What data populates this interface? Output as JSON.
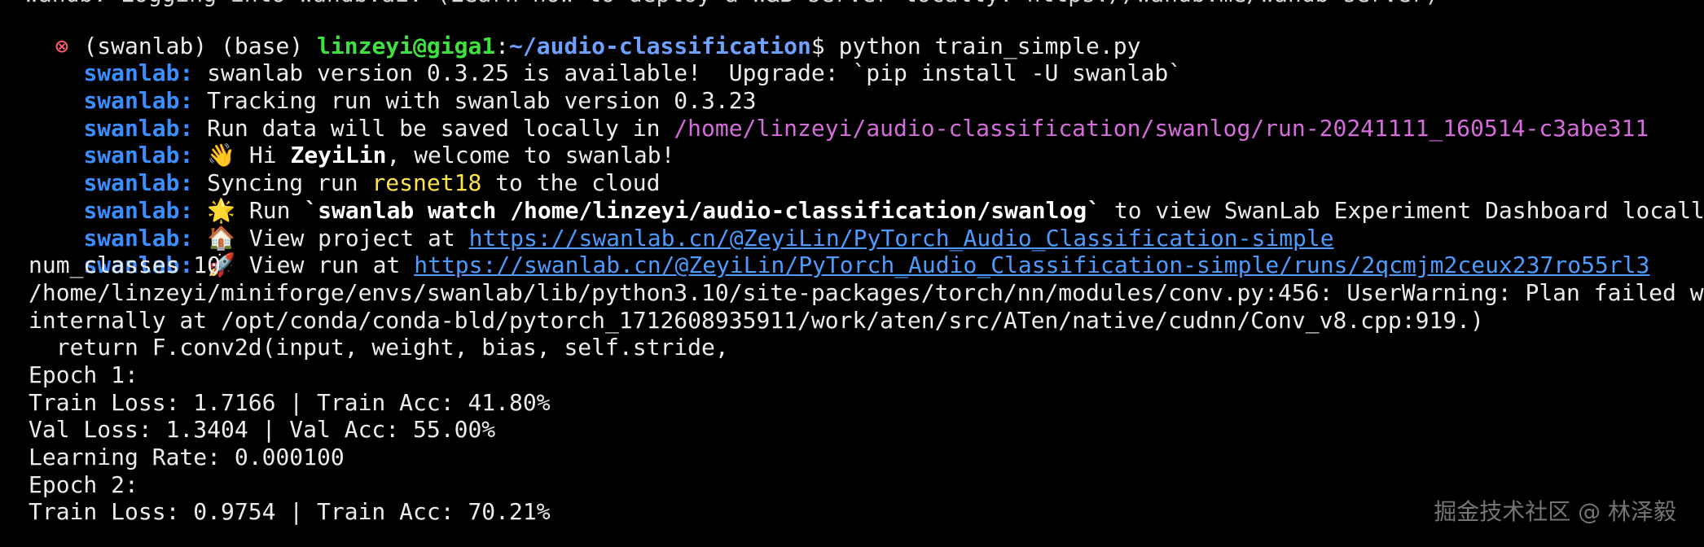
{
  "terminal": {
    "cut_line": "wandb: Logging into wandb.ai. (Learn how to deploy a W&B server locally: https://wandb.me/wandb-server)",
    "prompt": {
      "env": "(swanlab) (base) ",
      "user_host": "linzeyi@giga1",
      "colon": ":",
      "path": "~/audio-classification",
      "symbol": "$ ",
      "command": "python train_simple.py"
    },
    "prefix": "swanlab:",
    "lines": {
      "version_available": " swanlab version 0.3.25 is available!  Upgrade: `pip install -U swanlab`",
      "tracking": " Tracking run with swanlab version 0.3.23",
      "run_data_pre": " Run data will be saved locally in ",
      "run_data_path": "/home/linzeyi/audio-classification/swanlog/run-20241111_160514-c3abe311",
      "hi_icon": "👋",
      "hi_pre": " Hi ",
      "hi_name": "ZeyiLin",
      "hi_post": ", welcome to swanlab!",
      "sync_pre": " Syncing run ",
      "sync_run": "resnet18",
      "sync_post": " to the cloud",
      "watch_icon": "🌟",
      "watch_pre": " Run ",
      "watch_cmd": "`swanlab watch /home/linzeyi/audio-classification/swanlog`",
      "watch_post": " to view SwanLab Experiment Dashboard locally",
      "project_icon": "🏠",
      "project_pre": " View project at ",
      "project_url": "https://swanlab.cn/@ZeyiLin/PyTorch_Audio_Classification-simple",
      "run_icon": "🚀",
      "run_pre": " View run at ",
      "run_url": "https://swanlab.cn/@ZeyiLin/PyTorch_Audio_Classification-simple/runs/2qcmjm2ceux237ro55rl3"
    },
    "output": [
      "num_classes 10",
      "/home/linzeyi/miniforge/envs/swanlab/lib/python3.10/site-packages/torch/nn/modules/conv.py:456: UserWarning: Plan failed w",
      "internally at /opt/conda/conda-bld/pytorch_1712608935911/work/aten/src/ATen/native/cudnn/Conv_v8.cpp:919.)",
      "  return F.conv2d(input, weight, bias, self.stride,",
      "Epoch 1:",
      "Train Loss: 1.7166 | Train Acc: 41.80%",
      "Val Loss: 1.3404 | Val Acc: 55.00%",
      "Learning Rate: 0.000100",
      "Epoch 2:",
      "Train Loss: 0.9754 | Train Acc: 70.21%"
    ],
    "watermark": "掘金技术社区 @ 林泽毅"
  },
  "colors": {
    "background": "#000000",
    "text": "#ececec",
    "prefix": "#3b8eff",
    "user_host": "#3fe03f",
    "path": "#6ea0ff",
    "log_path": "#d46ddb",
    "run_name": "#ffe34d",
    "link": "#4d9bff",
    "error_icon": "#ff5f6d"
  }
}
